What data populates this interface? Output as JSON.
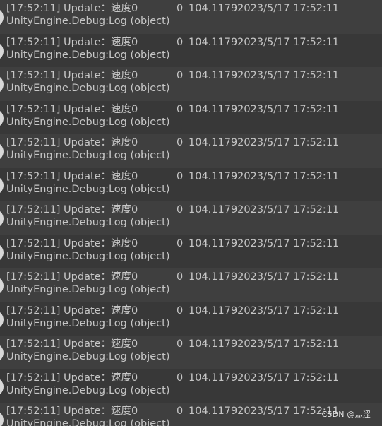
{
  "console": {
    "entries": [
      {
        "time": "[17:52:11]",
        "message": "Update：速度0",
        "zero": "0",
        "value": "104.11792023/5/17 17:52:11",
        "source": "UnityEngine.Debug:Log (object)"
      },
      {
        "time": "[17:52:11]",
        "message": "Update：速度0",
        "zero": "0",
        "value": "104.11792023/5/17 17:52:11",
        "source": "UnityEngine.Debug:Log (object)"
      },
      {
        "time": "[17:52:11]",
        "message": "Update：速度0",
        "zero": "0",
        "value": "104.11792023/5/17 17:52:11",
        "source": "UnityEngine.Debug:Log (object)"
      },
      {
        "time": "[17:52:11]",
        "message": "Update：速度0",
        "zero": "0",
        "value": "104.11792023/5/17 17:52:11",
        "source": "UnityEngine.Debug:Log (object)"
      },
      {
        "time": "[17:52:11]",
        "message": "Update：速度0",
        "zero": "0",
        "value": "104.11792023/5/17 17:52:11",
        "source": "UnityEngine.Debug:Log (object)"
      },
      {
        "time": "[17:52:11]",
        "message": "Update：速度0",
        "zero": "0",
        "value": "104.11792023/5/17 17:52:11",
        "source": "UnityEngine.Debug:Log (object)"
      },
      {
        "time": "[17:52:11]",
        "message": "Update：速度0",
        "zero": "0",
        "value": "104.11792023/5/17 17:52:11",
        "source": "UnityEngine.Debug:Log (object)"
      },
      {
        "time": "[17:52:11]",
        "message": "Update：速度0",
        "zero": "0",
        "value": "104.11792023/5/17 17:52:11",
        "source": "UnityEngine.Debug:Log (object)"
      },
      {
        "time": "[17:52:11]",
        "message": "Update：速度0",
        "zero": "0",
        "value": "104.11792023/5/17 17:52:11",
        "source": "UnityEngine.Debug:Log (object)"
      },
      {
        "time": "[17:52:11]",
        "message": "Update：速度0",
        "zero": "0",
        "value": "104.11792023/5/17 17:52:11",
        "source": "UnityEngine.Debug:Log (object)"
      },
      {
        "time": "[17:52:11]",
        "message": "Update：速度0",
        "zero": "0",
        "value": "104.11792023/5/17 17:52:11",
        "source": "UnityEngine.Debug:Log (object)"
      },
      {
        "time": "[17:52:11]",
        "message": "Update：速度0",
        "zero": "0",
        "value": "104.11792023/5/17 17:52:11",
        "source": "UnityEngine.Debug:Log (object)"
      },
      {
        "time": "[17:52:11]",
        "message": "Update：速度0",
        "zero": "0",
        "value": "104.11792023/5/17 17:52:11",
        "source": "UnityEngine.Debug:Log (object)"
      }
    ],
    "icon": "info-icon"
  },
  "watermark": "CSDN @灬涩"
}
